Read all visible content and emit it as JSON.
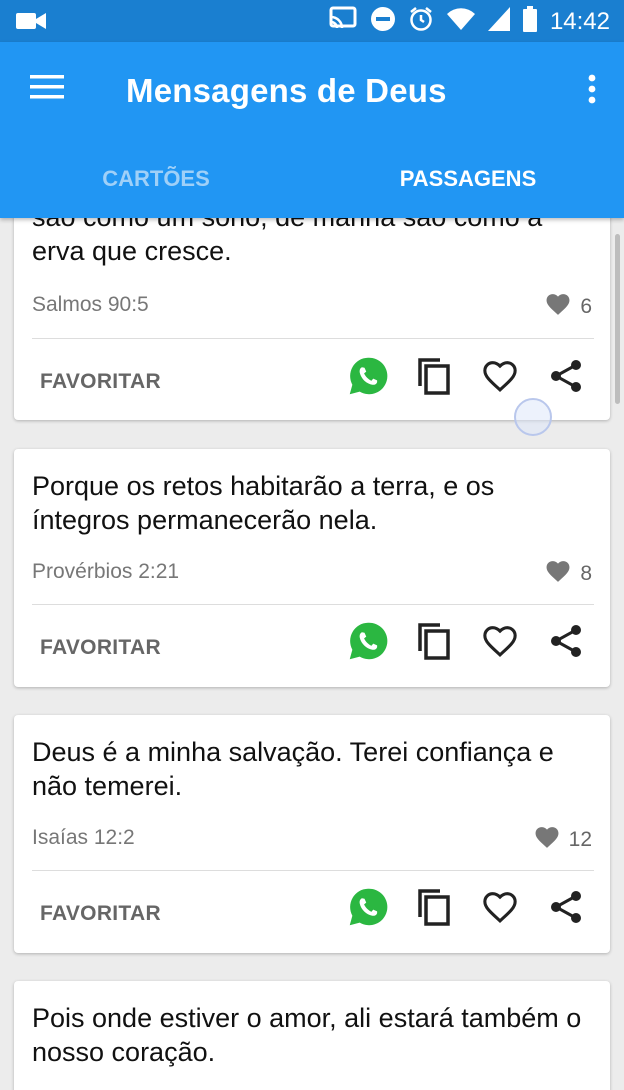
{
  "status_bar": {
    "time": "14:42"
  },
  "app_bar": {
    "title": "Mensagens de Deus"
  },
  "tabs": [
    {
      "label": "CARTÕES",
      "active": false
    },
    {
      "label": "PASSAGENS",
      "active": true
    }
  ],
  "cards": [
    {
      "text": "são como um sono; de manhã são como a erva que cresce.",
      "reference": "Salmos 90:5",
      "likes": "6",
      "favorite_label": "FAVORITAR"
    },
    {
      "text": "Porque os retos habitarão a terra, e os íntegros permanecerão nela.",
      "reference": "Provérbios 2:21",
      "likes": "8",
      "favorite_label": "FAVORITAR"
    },
    {
      "text": "Deus é a minha salvação. Terei confiança e não temerei.",
      "reference": "Isaías 12:2",
      "likes": "12",
      "favorite_label": "FAVORITAR"
    },
    {
      "text": "Pois onde estiver o amor, ali estará também o nosso coração.",
      "reference": "",
      "likes": "",
      "favorite_label": ""
    }
  ],
  "icons": [
    "menu-icon",
    "more-vert-icon",
    "whatsapp-icon",
    "copy-icon",
    "heart-outline-icon",
    "share-icon",
    "heart-filled-icon"
  ],
  "colors": {
    "primary": "#2196f3",
    "status_bar": "#1a7fd0",
    "whatsapp": "#2bb741"
  }
}
